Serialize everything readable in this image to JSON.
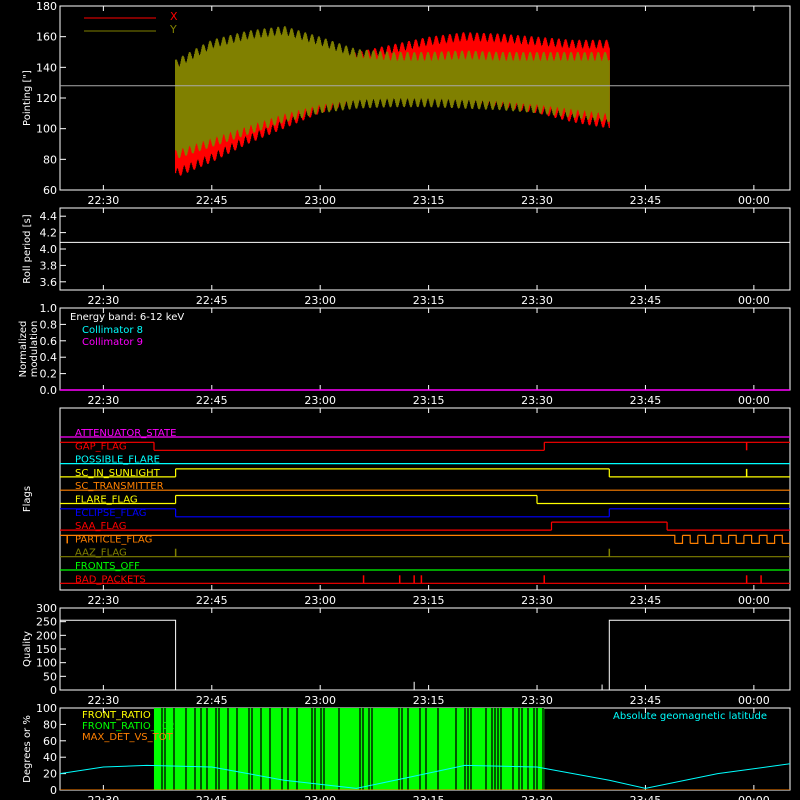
{
  "time_ticks": [
    "22:30",
    "22:45",
    "23:00",
    "23:15",
    "23:30",
    "23:45",
    "00:00"
  ],
  "colors": {
    "background": "#000000",
    "axes": "#ffffff",
    "x_series": "#ff0000",
    "y_series": "#808000",
    "cyan": "#00ffff",
    "magenta": "#ff00ff",
    "green": "#00ff00",
    "yellow": "#ffff00",
    "orange": "#ff8000",
    "blue": "#0000ff"
  },
  "chart_data": [
    {
      "id": "pointing",
      "type": "line",
      "ylabel": "Pointing [\"]",
      "ylim": [
        60,
        180
      ],
      "yticks": [
        60,
        80,
        100,
        120,
        140,
        160,
        180
      ],
      "legend_placement": "top-left",
      "reference_line": 128,
      "series": [
        {
          "name": "X",
          "color": "#ff0000",
          "x": [
            "22:40",
            "22:45",
            "22:50",
            "22:55",
            "23:00",
            "23:05",
            "23:10",
            "23:15",
            "23:20",
            "23:25",
            "23:30",
            "23:35",
            "23:40"
          ],
          "upper": [
            142,
            150,
            152,
            150,
            148,
            150,
            155,
            160,
            163,
            162,
            160,
            158,
            158
          ],
          "lower": [
            68,
            78,
            90,
            100,
            110,
            117,
            118,
            118,
            117,
            114,
            110,
            104,
            100
          ]
        },
        {
          "name": "Y",
          "color": "#808000",
          "x": [
            "22:40",
            "22:45",
            "22:50",
            "22:55",
            "23:00",
            "23:05",
            "23:10",
            "23:15",
            "23:20",
            "23:25",
            "23:30",
            "23:35",
            "23:40"
          ],
          "upper": [
            145,
            158,
            164,
            167,
            160,
            152,
            150,
            150,
            151,
            150,
            150,
            150,
            150
          ],
          "lower": [
            80,
            88,
            96,
            104,
            110,
            113,
            114,
            114,
            113,
            112,
            110,
            107,
            104
          ]
        }
      ]
    },
    {
      "id": "roll",
      "type": "line",
      "ylabel": "Roll period [s]",
      "ylim": [
        3.5,
        4.5
      ],
      "yticks": [
        "3.6",
        "3.8",
        "4.0",
        "4.2",
        "4.4"
      ],
      "series": [
        {
          "name": "",
          "color": "#ffffff",
          "x": [
            "22:24",
            "22:35",
            "22:40",
            "23:00",
            "23:30",
            "00:05"
          ],
          "values": [
            4.08,
            4.08,
            4.08,
            4.08,
            4.08,
            4.08
          ]
        }
      ]
    },
    {
      "id": "modulation",
      "type": "line",
      "ylabel": "Normalized modulation",
      "ylim": [
        0.0,
        1.0
      ],
      "yticks": [
        "0.0",
        "0.2",
        "0.4",
        "0.6",
        "0.8",
        "1.0"
      ],
      "legend_title": "Energy band: 6-12 keV",
      "series": [
        {
          "name": "Collimator 8",
          "color": "#00ffff",
          "x": [],
          "values": []
        },
        {
          "name": "Collimator 9",
          "color": "#ff00ff",
          "x": [
            "22:24",
            "00:05"
          ],
          "values": [
            0.0,
            0.0
          ]
        }
      ]
    },
    {
      "id": "flags",
      "type": "line",
      "ylabel": "Flags",
      "flags": [
        {
          "name": "ATTENUATOR_STATE",
          "color": "#ff00ff",
          "segments": [
            {
              "from": "22:24",
              "to": "00:05",
              "state": 0
            }
          ],
          "spikes": []
        },
        {
          "name": "GAP_FLAG",
          "color": "#ff0000",
          "segments": [
            {
              "from": "22:24",
              "to": "22:37",
              "state": 1
            },
            {
              "from": "22:37",
              "to": "23:31",
              "state": 0
            },
            {
              "from": "23:31",
              "to": "00:05",
              "state": 1
            }
          ],
          "spikes": [
            "23:59"
          ]
        },
        {
          "name": "POSSIBLE_FLARE",
          "color": "#00ffff",
          "segments": [
            {
              "from": "22:24",
              "to": "00:05",
              "state": 0
            }
          ],
          "spikes": []
        },
        {
          "name": "SC_IN_SUNLIGHT",
          "color": "#ffff00",
          "segments": [
            {
              "from": "22:24",
              "to": "22:40",
              "state": 0
            },
            {
              "from": "22:40",
              "to": "23:40",
              "state": 1
            },
            {
              "from": "23:40",
              "to": "00:05",
              "state": 0
            }
          ],
          "spikes": [
            "23:59"
          ]
        },
        {
          "name": "SC_TRANSMITTER",
          "color": "#ff8000",
          "segments": [
            {
              "from": "22:24",
              "to": "00:05",
              "state": 0
            }
          ],
          "spikes": []
        },
        {
          "name": "FLARE_FLAG",
          "color": "#ffff00",
          "segments": [
            {
              "from": "22:24",
              "to": "22:40",
              "state": 0
            },
            {
              "from": "22:40",
              "to": "23:30",
              "state": 1
            },
            {
              "from": "23:30",
              "to": "00:05",
              "state": 0
            }
          ],
          "spikes": []
        },
        {
          "name": "ECLIPSE_FLAG",
          "color": "#0000ff",
          "segments": [
            {
              "from": "22:24",
              "to": "22:40",
              "state": 1
            },
            {
              "from": "22:40",
              "to": "23:40",
              "state": 0
            },
            {
              "from": "23:40",
              "to": "00:05",
              "state": 1
            }
          ],
          "spikes": []
        },
        {
          "name": "SAA_FLAG",
          "color": "#ff0000",
          "segments": [
            {
              "from": "22:24",
              "to": "23:32",
              "state": 0
            },
            {
              "from": "23:32",
              "to": "23:48",
              "state": 1
            },
            {
              "from": "23:48",
              "to": "00:05",
              "state": 0
            }
          ],
          "spikes": []
        },
        {
          "name": "PARTICLE_FLAG",
          "color": "#ff8000",
          "segments": [
            {
              "from": "22:24",
              "to": "23:48",
              "state": 1
            },
            {
              "from": "23:48",
              "to": "00:05",
              "state": "toggle"
            }
          ],
          "spikes": [
            "22:25"
          ]
        },
        {
          "name": "AAZ_FLAG",
          "color": "#808000",
          "segments": [
            {
              "from": "22:24",
              "to": "00:05",
              "state": 0
            }
          ],
          "spikes": [
            "22:40",
            "23:40"
          ]
        },
        {
          "name": "FRONTS_OFF",
          "color": "#00ff00",
          "segments": [
            {
              "from": "22:24",
              "to": "00:05",
              "state": 0
            }
          ],
          "spikes": []
        },
        {
          "name": "BAD_PACKETS",
          "color": "#ff0000",
          "segments": [
            {
              "from": "22:24",
              "to": "00:05",
              "state": 0
            }
          ],
          "spikes": [
            "23:06",
            "23:11",
            "23:13",
            "23:14",
            "23:31",
            "23:59",
            "00:01"
          ]
        }
      ]
    },
    {
      "id": "quality",
      "type": "line",
      "ylabel": "Quality",
      "ylim": [
        0,
        300
      ],
      "yticks": [
        0,
        50,
        100,
        150,
        200,
        250,
        300
      ],
      "series": [
        {
          "name": "",
          "color": "#ffffff",
          "x": [
            "22:24",
            "22:40",
            "22:40",
            "23:40",
            "23:40",
            "00:05"
          ],
          "values": [
            255,
            255,
            0,
            0,
            255,
            255
          ],
          "spikes": [
            {
              "x": "23:13",
              "value": 30
            },
            {
              "x": "23:39",
              "value": 20
            }
          ]
        }
      ]
    },
    {
      "id": "ratios",
      "type": "line",
      "ylabel": "Degrees or %",
      "ylim": [
        0,
        100
      ],
      "yticks": [
        0,
        20,
        40,
        60,
        80,
        100
      ],
      "series": [
        {
          "name": "FRONT_RATIO",
          "color": "#ffff00",
          "x": [],
          "values": []
        },
        {
          "name": "FRONT_RATIO_1023",
          "color": "#00ff00",
          "x": [
            "22:37",
            "23:31"
          ],
          "values": [
            100,
            100
          ],
          "display": "dense-bars"
        },
        {
          "name": "MAX_DET_VS_TOT",
          "color": "#ff8000",
          "x": [
            "22:24",
            "00:05"
          ],
          "values": [
            0,
            0
          ]
        },
        {
          "name": "Absolute geomagnetic latitude",
          "color": "#00ffff",
          "x": [
            "22:24",
            "22:30",
            "22:36",
            "22:45",
            "22:55",
            "23:05",
            "23:12",
            "23:20",
            "23:30",
            "23:40",
            "23:45",
            "23:55",
            "00:05"
          ],
          "values": [
            20,
            28,
            30,
            28,
            12,
            2,
            15,
            30,
            28,
            12,
            2,
            20,
            32
          ]
        }
      ]
    }
  ]
}
